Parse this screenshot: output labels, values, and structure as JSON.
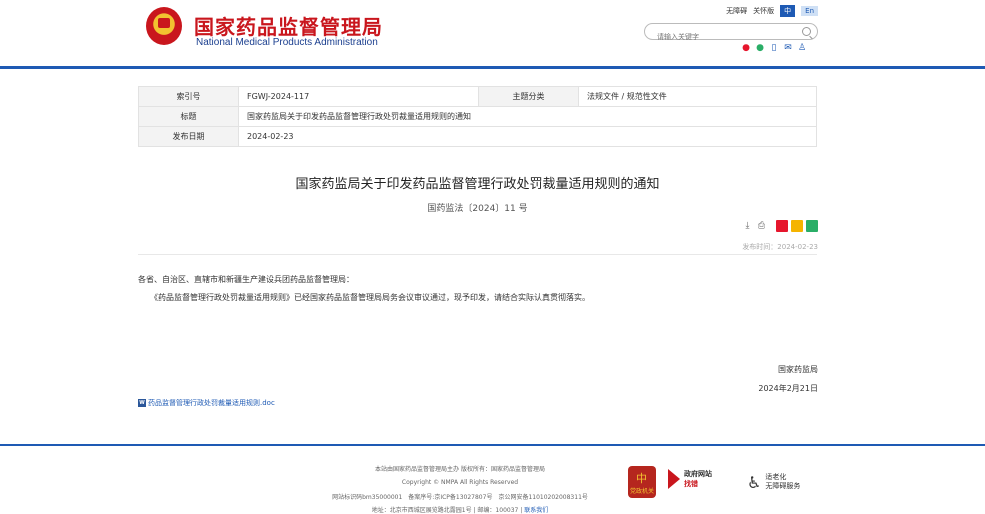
{
  "header": {
    "title": "国家药品监督管理局",
    "subtitle": "National Medical Products Administration",
    "links": [
      "无障碍",
      "关怀版"
    ],
    "lang_zh": "中",
    "lang_en": "En",
    "search_placeholder": "请输入关键字"
  },
  "meta": {
    "index_label": "索引号",
    "index_value": "FGWJ-2024-117",
    "category_label": "主题分类",
    "category_value": "法规文件 / 规范性文件",
    "title_label": "标题",
    "title_value": "国家药监局关于印发药品监督管理行政处罚裁量适用规则的通知",
    "date_label": "发布日期",
    "date_value": "2024-02-23"
  },
  "article": {
    "title": "国家药监局关于印发药品监督管理行政处罚裁量适用规则的通知",
    "doc_number": "国药监法〔2024〕11 号",
    "publish_time": "发布时间：2024-02-23",
    "para1": "各省、自治区、直辖市和新疆生产建设兵团药品监督管理局：",
    "para2": "《药品监督管理行政处罚裁量适用规则》已经国家药品监督管理局局务会议审议通过，现予印发，请结合实际认真贯彻落实。",
    "signature_org": "国家药监局",
    "signature_date": "2024年2月21日",
    "attachment": "药品监督管理行政处罚裁量适用规则.doc"
  },
  "footer": {
    "line1": "本站由国家药品监督管理局主办 版权所有：国家药品监督管理局",
    "line2": "Copyright © NMPA All Rights Reserved",
    "line3": "网站标识码bm35000001　备案序号:京ICP备13027807号　京公网安备11010202008311号",
    "line4_prefix": "地址：北京市西城区展览路北露园1号 | 邮编：100037 |",
    "line4_link": "联系我们",
    "guard_text": "党政机关",
    "gov_line1": "政府网站",
    "gov_line2": "找错",
    "access_line1": "适老化",
    "access_line2": "无障碍服务"
  },
  "colors": {
    "brand_red": "#c9161d",
    "brand_blue": "#1e5ab4"
  }
}
